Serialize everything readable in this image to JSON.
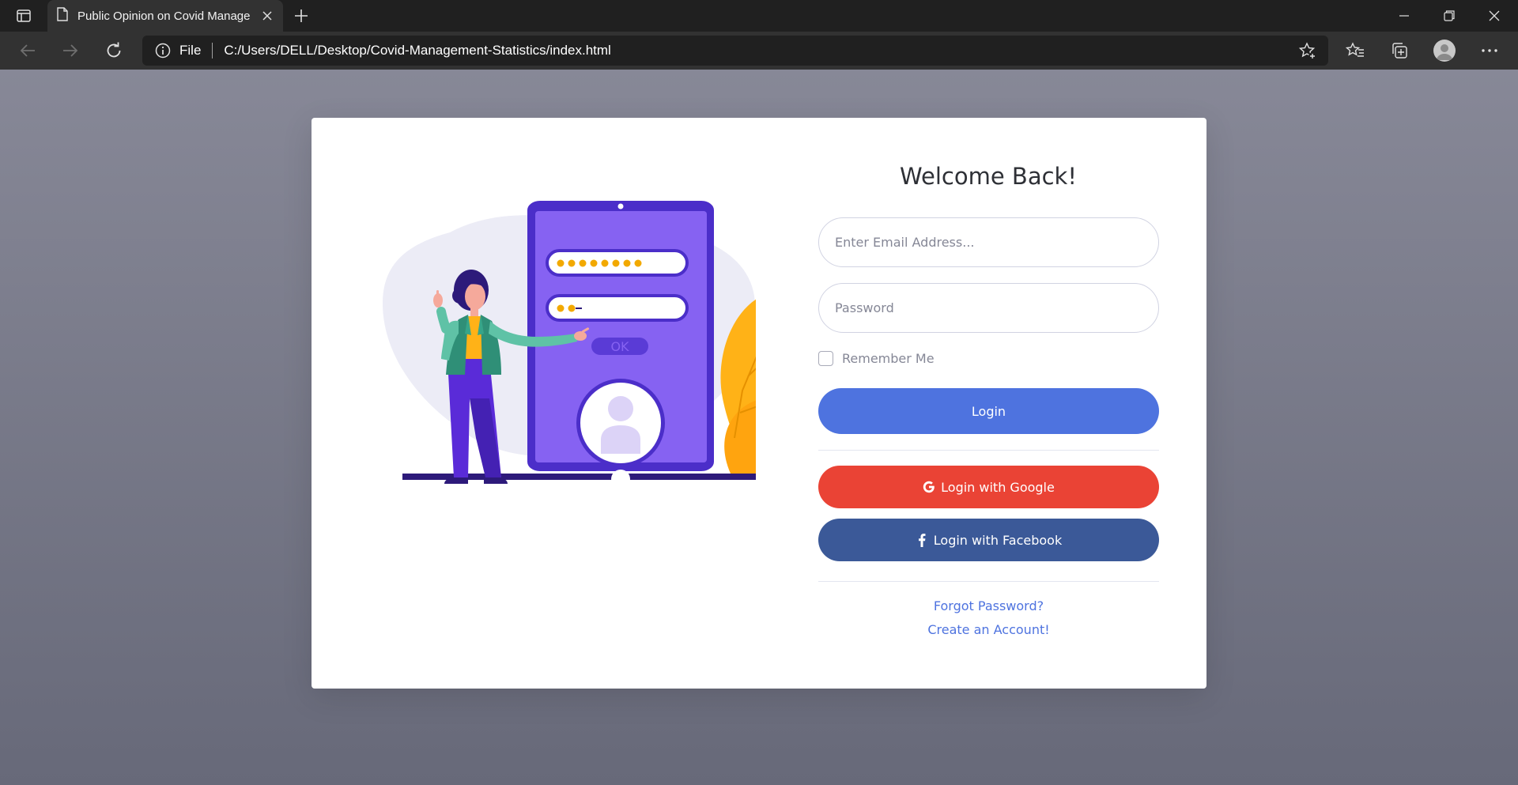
{
  "browser": {
    "tab_title": "Public Opinion on Covid Management Statistics",
    "address_prefix": "File",
    "url": "C:/Users/DELL/Desktop/Covid-Management-Statistics/index.html"
  },
  "login": {
    "title": "Welcome Back!",
    "email_placeholder": "Enter Email Address...",
    "password_placeholder": "Password",
    "remember_label": "Remember Me",
    "login_button": "Login",
    "google_button": "Login with Google",
    "facebook_button": "Login with Facebook",
    "forgot_link": "Forgot Password?",
    "create_link": "Create an Account!"
  },
  "illustration": {
    "ok_label": "OK"
  },
  "colors": {
    "primary": "#4e73df",
    "google": "#ea4335",
    "facebook": "#3b5998",
    "phone": "#4b2ec9",
    "screen": "#8662f2"
  }
}
